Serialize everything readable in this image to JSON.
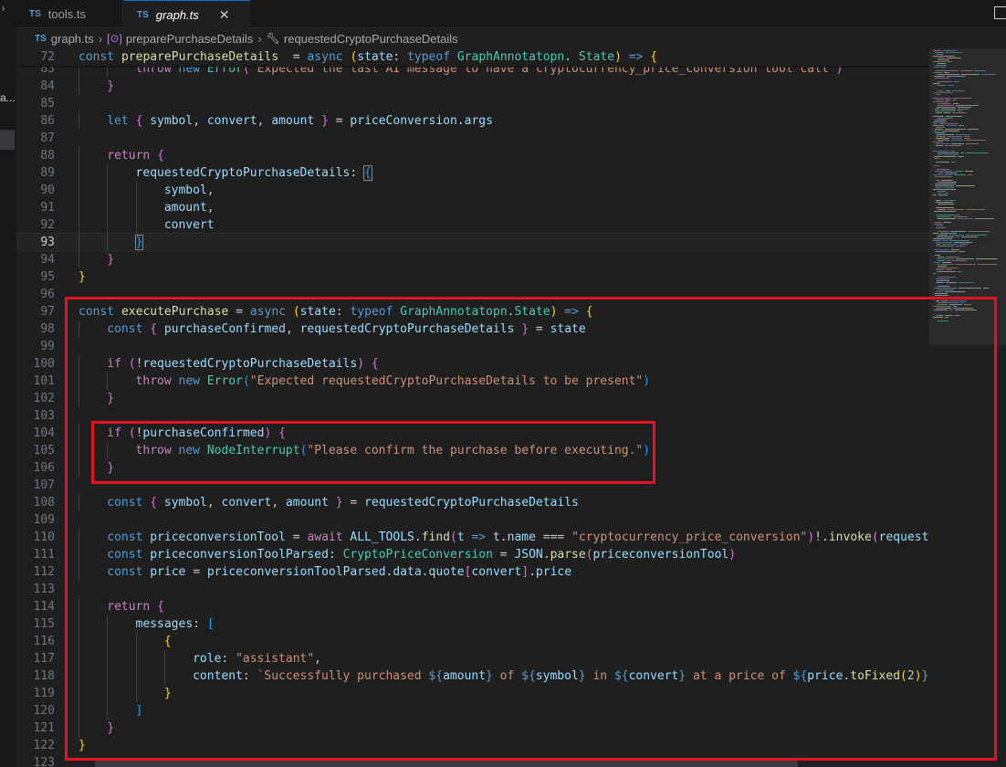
{
  "tabs": [
    {
      "badge": "TS",
      "label": "tools.ts"
    },
    {
      "badge": "TS",
      "label": "graph.ts",
      "close": "✕"
    }
  ],
  "sidebar": {
    "truncated_text": "a..."
  },
  "breadcrumb": {
    "badge": "TS",
    "file": "graph.ts",
    "symbol": "preparePurchaseDetails",
    "property": "requestedCryptoPurchaseDetails"
  },
  "editor": {
    "current_line": 93,
    "lines": [
      {
        "num": "72",
        "indent": 0,
        "sticky": true,
        "tokens": [
          [
            "k",
            "const "
          ],
          [
            "f",
            "preparePurchaseDetails"
          ],
          [
            "",
            "  = "
          ],
          [
            "k",
            "async "
          ],
          [
            "p1",
            "("
          ],
          [
            "v",
            "state"
          ],
          [
            "",
            ": "
          ],
          [
            "k",
            "typeof "
          ],
          [
            "t",
            "GraphAnnotatopn"
          ],
          [
            "",
            ". "
          ],
          [
            "t",
            "State"
          ],
          [
            "p1",
            ")"
          ],
          [
            "",
            " "
          ],
          [
            "k",
            "=>"
          ],
          [
            "",
            " "
          ],
          [
            "p1",
            "{"
          ]
        ]
      },
      {
        "num": "83",
        "indent": 2,
        "partial": true,
        "tokens": [
          [
            "c",
            "throw "
          ],
          [
            "k",
            "new "
          ],
          [
            "t",
            "Error"
          ],
          [
            "p2",
            "("
          ],
          [
            "s",
            "'Expected the last AI message to have a cryptocurrency_price_conversion tool call'"
          ],
          [
            "p2",
            ")"
          ]
        ]
      },
      {
        "num": "84",
        "indent": 1,
        "tokens": [
          [
            "p2",
            "}"
          ]
        ]
      },
      {
        "num": "85",
        "indent": 0,
        "tokens": []
      },
      {
        "num": "86",
        "indent": 1,
        "tokens": [
          [
            "k",
            "let "
          ],
          [
            "p2",
            "{ "
          ],
          [
            "v",
            "symbol"
          ],
          [
            "",
            ", "
          ],
          [
            "v",
            "convert"
          ],
          [
            "",
            ", "
          ],
          [
            "v",
            "amount "
          ],
          [
            "p2",
            "}"
          ],
          [
            "",
            " = "
          ],
          [
            "v",
            "priceConversion"
          ],
          [
            "",
            "."
          ],
          [
            "v",
            "args"
          ]
        ]
      },
      {
        "num": "87",
        "indent": 0,
        "tokens": []
      },
      {
        "num": "88",
        "indent": 1,
        "tokens": [
          [
            "c",
            "return "
          ],
          [
            "p2",
            "{"
          ]
        ]
      },
      {
        "num": "89",
        "indent": 2,
        "tokens": [
          [
            "v",
            "requestedCryptoPurchaseDetails"
          ],
          [
            "",
            ": "
          ],
          [
            "p3b",
            "{"
          ]
        ]
      },
      {
        "num": "90",
        "indent": 3,
        "tokens": [
          [
            "v",
            "symbol"
          ],
          [
            "",
            ","
          ]
        ]
      },
      {
        "num": "91",
        "indent": 3,
        "tokens": [
          [
            "v",
            "amount"
          ],
          [
            "",
            ","
          ]
        ]
      },
      {
        "num": "92",
        "indent": 3,
        "tokens": [
          [
            "v",
            "convert"
          ]
        ]
      },
      {
        "num": "93",
        "indent": 2,
        "tokens": [
          [
            "p3b",
            "}"
          ]
        ]
      },
      {
        "num": "94",
        "indent": 1,
        "tokens": [
          [
            "p2",
            "}"
          ]
        ]
      },
      {
        "num": "95",
        "indent": 0,
        "tokens": [
          [
            "p1",
            "}"
          ]
        ]
      },
      {
        "num": "96",
        "indent": 0,
        "tokens": []
      },
      {
        "num": "97",
        "indent": 0,
        "tokens": [
          [
            "k",
            "const "
          ],
          [
            "f",
            "executePurchase"
          ],
          [
            "",
            " = "
          ],
          [
            "k",
            "async "
          ],
          [
            "p1",
            "("
          ],
          [
            "v",
            "state"
          ],
          [
            "",
            ": "
          ],
          [
            "k",
            "typeof "
          ],
          [
            "t",
            "GraphAnnotatopn"
          ],
          [
            "",
            "."
          ],
          [
            "t",
            "State"
          ],
          [
            "p1",
            ")"
          ],
          [
            "",
            " "
          ],
          [
            "k",
            "=>"
          ],
          [
            "",
            " "
          ],
          [
            "p1",
            "{"
          ]
        ]
      },
      {
        "num": "98",
        "indent": 1,
        "tokens": [
          [
            "k",
            "const "
          ],
          [
            "p2",
            "{ "
          ],
          [
            "v",
            "purchaseConfirmed"
          ],
          [
            "",
            ", "
          ],
          [
            "v",
            "requestedCryptoPurchaseDetails "
          ],
          [
            "p2",
            "}"
          ],
          [
            "",
            " = "
          ],
          [
            "v",
            "state"
          ]
        ]
      },
      {
        "num": "99",
        "indent": 0,
        "tokens": []
      },
      {
        "num": "100",
        "indent": 1,
        "tokens": [
          [
            "c",
            "if "
          ],
          [
            "p2",
            "("
          ],
          [
            "",
            "!"
          ],
          [
            "v",
            "requestedCryptoPurchaseDetails"
          ],
          [
            "p2",
            ")"
          ],
          [
            "",
            " "
          ],
          [
            "p2",
            "{"
          ]
        ]
      },
      {
        "num": "101",
        "indent": 2,
        "tokens": [
          [
            "c",
            "throw "
          ],
          [
            "k",
            "new "
          ],
          [
            "t",
            "Error"
          ],
          [
            "p3",
            "("
          ],
          [
            "s",
            "\"Expected requestedCryptoPurchaseDetails to be present\""
          ],
          [
            "p3",
            ")"
          ]
        ]
      },
      {
        "num": "102",
        "indent": 1,
        "tokens": [
          [
            "p2",
            "}"
          ]
        ]
      },
      {
        "num": "103",
        "indent": 0,
        "tokens": []
      },
      {
        "num": "104",
        "indent": 1,
        "tokens": [
          [
            "c",
            "if "
          ],
          [
            "p2",
            "("
          ],
          [
            "",
            "!"
          ],
          [
            "v",
            "purchaseConfirmed"
          ],
          [
            "p2",
            ")"
          ],
          [
            "",
            " "
          ],
          [
            "p2",
            "{"
          ]
        ]
      },
      {
        "num": "105",
        "indent": 2,
        "tokens": [
          [
            "c",
            "throw "
          ],
          [
            "k",
            "new "
          ],
          [
            "t",
            "NodeInterrupt"
          ],
          [
            "p3",
            "("
          ],
          [
            "s",
            "\"Please confirm the purchase before executing.\""
          ],
          [
            "p3",
            ")"
          ]
        ]
      },
      {
        "num": "106",
        "indent": 1,
        "tokens": [
          [
            "p2",
            "}"
          ]
        ]
      },
      {
        "num": "107",
        "indent": 0,
        "tokens": []
      },
      {
        "num": "108",
        "indent": 1,
        "tokens": [
          [
            "k",
            "const "
          ],
          [
            "p2",
            "{ "
          ],
          [
            "v",
            "symbol"
          ],
          [
            "",
            ", "
          ],
          [
            "v",
            "convert"
          ],
          [
            "",
            ", "
          ],
          [
            "v",
            "amount "
          ],
          [
            "p2",
            "}"
          ],
          [
            "",
            " = "
          ],
          [
            "v",
            "requestedCryptoPurchaseDetails"
          ]
        ]
      },
      {
        "num": "109",
        "indent": 0,
        "tokens": []
      },
      {
        "num": "110",
        "indent": 1,
        "tokens": [
          [
            "k",
            "const "
          ],
          [
            "v",
            "priceconversionTool"
          ],
          [
            "",
            " = "
          ],
          [
            "c",
            "await "
          ],
          [
            "v",
            "ALL_TOOLS"
          ],
          [
            "",
            "."
          ],
          [
            "f",
            "find"
          ],
          [
            "p2",
            "("
          ],
          [
            "v",
            "t"
          ],
          [
            "",
            " "
          ],
          [
            "k",
            "=>"
          ],
          [
            "",
            " "
          ],
          [
            "v",
            "t"
          ],
          [
            "",
            "."
          ],
          [
            "v",
            "name"
          ],
          [
            "",
            " === "
          ],
          [
            "s",
            "\"cryptocurrency_price_conversion\""
          ],
          [
            "p2",
            ")"
          ],
          [
            "",
            "!."
          ],
          [
            "f",
            "invoke"
          ],
          [
            "p2",
            "("
          ],
          [
            "v",
            "requested"
          ]
        ]
      },
      {
        "num": "111",
        "indent": 1,
        "tokens": [
          [
            "k",
            "const "
          ],
          [
            "v",
            "priceconversionToolParsed"
          ],
          [
            "",
            ": "
          ],
          [
            "t",
            "CryptoPriceConversion"
          ],
          [
            "",
            " = "
          ],
          [
            "v",
            "JSON"
          ],
          [
            "",
            "."
          ],
          [
            "f",
            "parse"
          ],
          [
            "p2",
            "("
          ],
          [
            "v",
            "priceconversionTool"
          ],
          [
            "p2",
            ")"
          ]
        ]
      },
      {
        "num": "112",
        "indent": 1,
        "tokens": [
          [
            "k",
            "const "
          ],
          [
            "v",
            "price"
          ],
          [
            "",
            " = "
          ],
          [
            "v",
            "priceconversionToolParsed"
          ],
          [
            "",
            "."
          ],
          [
            "v",
            "data"
          ],
          [
            "",
            "."
          ],
          [
            "v",
            "quote"
          ],
          [
            "p2",
            "["
          ],
          [
            "v",
            "convert"
          ],
          [
            "p2",
            "]"
          ],
          [
            "",
            "."
          ],
          [
            "v",
            "price"
          ]
        ]
      },
      {
        "num": "113",
        "indent": 0,
        "tokens": []
      },
      {
        "num": "114",
        "indent": 1,
        "tokens": [
          [
            "c",
            "return "
          ],
          [
            "p2",
            "{"
          ]
        ]
      },
      {
        "num": "115",
        "indent": 2,
        "tokens": [
          [
            "v",
            "messages"
          ],
          [
            "",
            ": "
          ],
          [
            "p3",
            "["
          ]
        ]
      },
      {
        "num": "116",
        "indent": 3,
        "tokens": [
          [
            "p1",
            "{"
          ]
        ]
      },
      {
        "num": "117",
        "indent": 4,
        "tokens": [
          [
            "v",
            "role"
          ],
          [
            "",
            ": "
          ],
          [
            "s",
            "\"assistant\""
          ],
          [
            "",
            ","
          ]
        ]
      },
      {
        "num": "118",
        "indent": 4,
        "tokens": [
          [
            "v",
            "content"
          ],
          [
            "",
            ": "
          ],
          [
            "s",
            "`Successfully purchased "
          ],
          [
            "k",
            "${"
          ],
          [
            "v",
            "amount"
          ],
          [
            "k",
            "}"
          ],
          [
            "s",
            " of "
          ],
          [
            "k",
            "${"
          ],
          [
            "v",
            "symbol"
          ],
          [
            "k",
            "}"
          ],
          [
            "s",
            " in "
          ],
          [
            "k",
            "${"
          ],
          [
            "v",
            "convert"
          ],
          [
            "k",
            "}"
          ],
          [
            "s",
            " at a price of "
          ],
          [
            "k",
            "${"
          ],
          [
            "v",
            "price"
          ],
          [
            "",
            "."
          ],
          [
            "f",
            "toFixed"
          ],
          [
            "p1",
            "("
          ],
          [
            "n",
            "2"
          ],
          [
            "p1",
            ")"
          ],
          [
            "k",
            "}"
          ],
          [
            "s",
            "`"
          ]
        ]
      },
      {
        "num": "119",
        "indent": 3,
        "tokens": [
          [
            "p1",
            "}"
          ]
        ]
      },
      {
        "num": "120",
        "indent": 2,
        "tokens": [
          [
            "p3",
            "]"
          ]
        ]
      },
      {
        "num": "121",
        "indent": 1,
        "tokens": [
          [
            "p2",
            "}"
          ]
        ]
      },
      {
        "num": "122",
        "indent": 0,
        "tokens": [
          [
            "p1",
            "}"
          ]
        ]
      },
      {
        "num": "123",
        "indent": 0,
        "tokens": []
      }
    ]
  },
  "colors": {
    "highlight_box": "#e81123",
    "keyword": "#569cd6",
    "control": "#c586c0",
    "variable": "#9cdcfe",
    "function": "#dcdcaa",
    "type": "#4ec9b0",
    "string": "#ce9178"
  }
}
